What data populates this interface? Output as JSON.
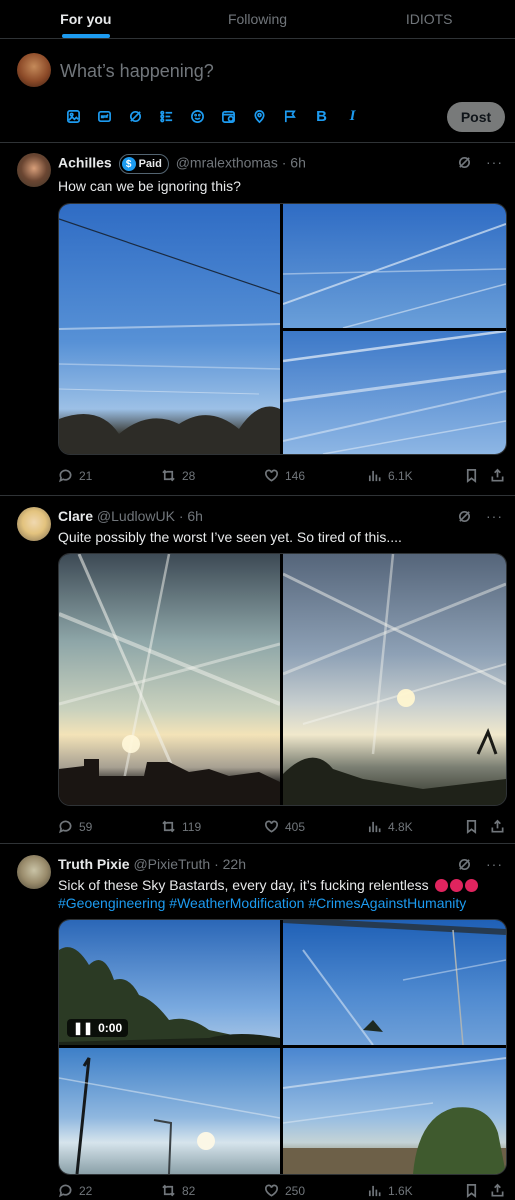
{
  "tabs": [
    {
      "label": "For you",
      "active": true
    },
    {
      "label": "Following",
      "active": false
    },
    {
      "label": "IDIOTS",
      "active": false
    }
  ],
  "compose": {
    "placeholder": "What’s happening?",
    "post_label": "Post",
    "toolbar_icons": [
      "image-icon",
      "gif-icon",
      "grok-icon",
      "poll-icon",
      "emoji-icon",
      "schedule-icon",
      "location-icon",
      "flag-icon",
      "bold-icon",
      "italic-icon"
    ],
    "bold_label": "B",
    "italic_label": "I"
  },
  "accent_color": "#1d9bf0",
  "tweets": [
    {
      "name": "Achilles",
      "paid_badge": "Paid",
      "handle_time": "@mralexthomas · 6h",
      "text": "How can we be ignoring this?",
      "replies": "21",
      "reposts": "28",
      "likes": "146",
      "views": "6.1K"
    },
    {
      "name": "Clare",
      "handle_time": "@LudlowUK · 6h",
      "text": "Quite possibly the worst I’ve seen yet. So tired of this....",
      "replies": "59",
      "reposts": "119",
      "likes": "405",
      "views": "4.8K"
    },
    {
      "name": "Truth Pixie",
      "handle_time": "@PixieTruth · 22h",
      "text": "Sick of these Sky Bastards, every day, it’s fucking relentless",
      "hashtags": "#Geoengineering #WeatherModification #CrimesAgainstHumanity",
      "video_time": "0:00",
      "replies": "22",
      "reposts": "82",
      "likes": "250",
      "views": "1.6K"
    }
  ]
}
